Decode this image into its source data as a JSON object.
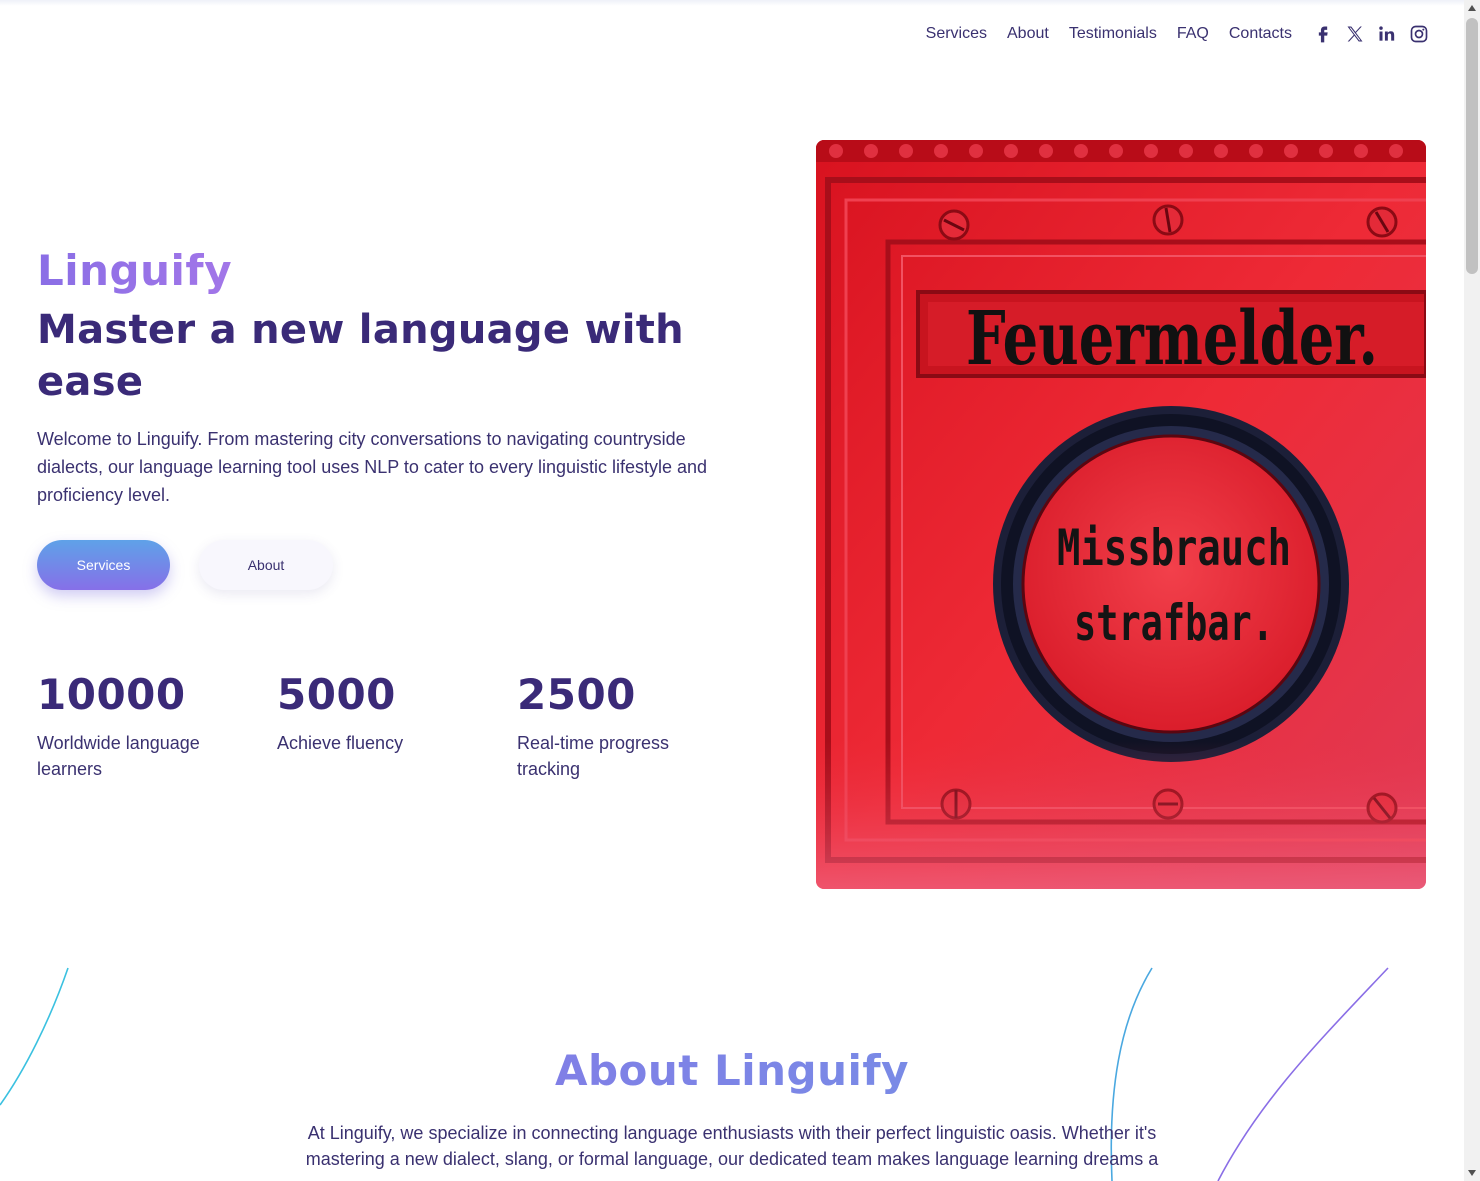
{
  "nav": {
    "links": [
      "Services",
      "About",
      "Testimonials",
      "FAQ",
      "Contacts"
    ],
    "social": [
      "facebook-icon",
      "x-twitter-icon",
      "linkedin-icon",
      "instagram-icon"
    ]
  },
  "hero": {
    "brand": "Linguify",
    "headline": "Master a new language with ease",
    "description": "Welcome to Linguify. From mastering city conversations to navigating countryside dialects, our language learning tool uses NLP to cater to every linguistic lifestyle and proficiency level.",
    "primary_button": "Services",
    "secondary_button": "About",
    "stats": [
      {
        "value": "10000",
        "label": "Worldwide language learners"
      },
      {
        "value": "5000",
        "label": "Achieve fluency"
      },
      {
        "value": "2500",
        "label": "Real-time progress tracking"
      }
    ],
    "image": {
      "sign_top": "Feuermelder.",
      "sign_line1": "Missbrauch",
      "sign_line2": "strafbar."
    }
  },
  "about": {
    "title": "About Linguify",
    "text": "At Linguify, we specialize in connecting language enthusiasts with their perfect linguistic oasis. Whether it's mastering a new dialect, slang, or formal language, our dedicated team makes language learning dreams a"
  },
  "colors": {
    "primary_text": "#3a2a78",
    "brand_gradient_start": "#8a6ee6",
    "brand_gradient_end": "#6f9be6",
    "button_gradient_start": "#5fa2e8",
    "button_gradient_end": "#8670e8",
    "photo_red": "#e8222e"
  }
}
